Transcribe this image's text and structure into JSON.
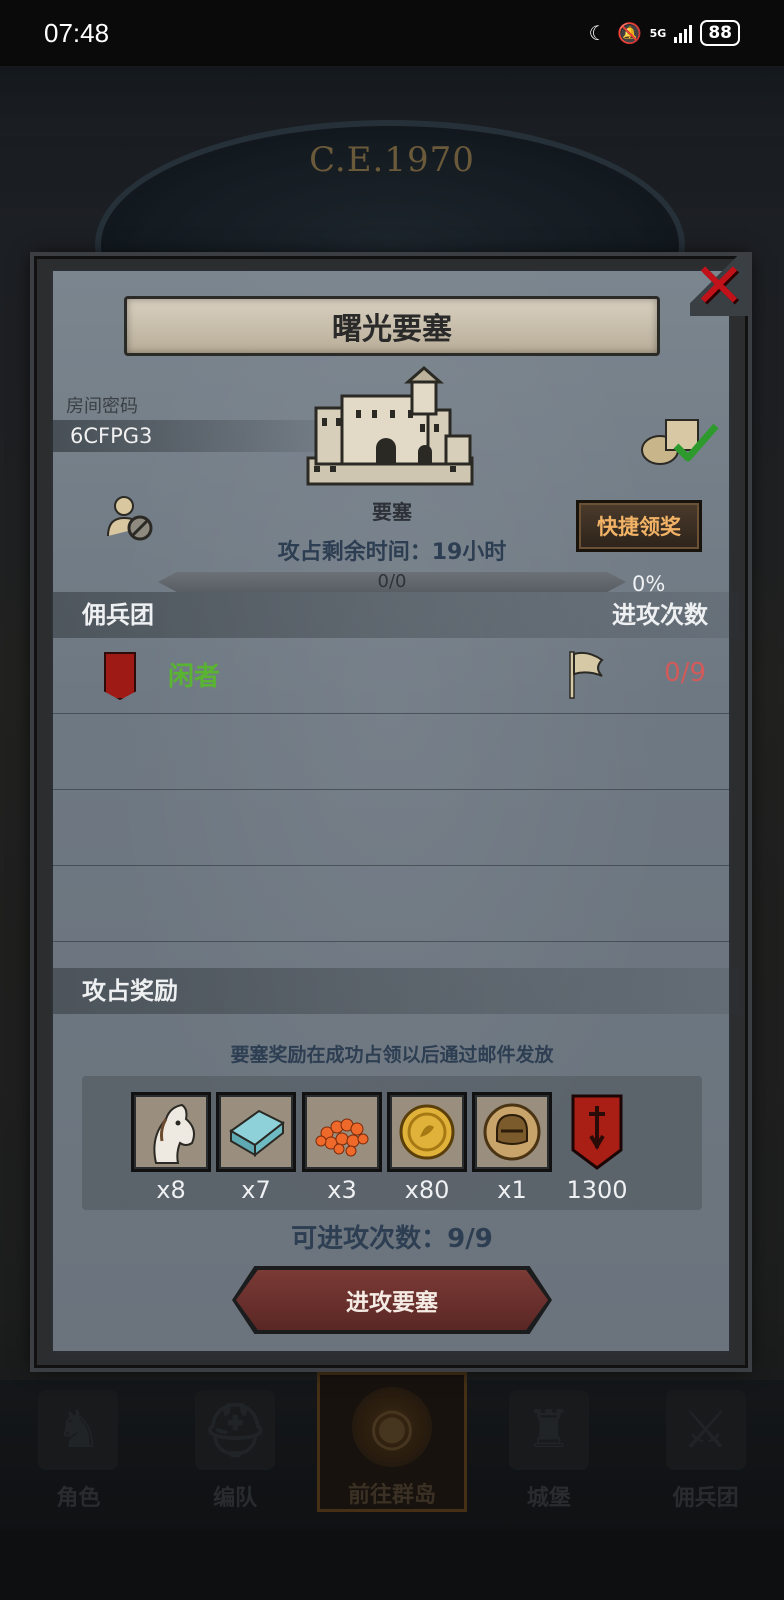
{
  "status_bar": {
    "time": "07:48",
    "network": "5G",
    "battery": "88"
  },
  "background": {
    "era": "C.E.1970"
  },
  "dialog": {
    "title": "曙光要塞",
    "room_label": "房间密码",
    "room_code": "6CFPG3",
    "castle_label": "要塞",
    "time_left": "攻占剩余时间：19小时",
    "quick_claim_label": "快捷领奖",
    "progress": {
      "text": "0/0",
      "percent_label": "0%",
      "fraction": 0
    },
    "mercenary": {
      "header_left": "佣兵团",
      "header_right": "进攻次数",
      "rows": [
        {
          "name": "闲者",
          "attacks": "0/9"
        }
      ]
    },
    "rewards": {
      "header": "攻占奖励",
      "note": "要塞奖励在成功占领以后通过邮件发放",
      "items": [
        {
          "icon": "horse-icon",
          "qty": "x8"
        },
        {
          "icon": "cloth-icon",
          "qty": "x7"
        },
        {
          "icon": "fish-roe-icon",
          "qty": "x3"
        },
        {
          "icon": "gold-coin-icon",
          "qty": "x80"
        },
        {
          "icon": "knight-helmet-icon",
          "qty": "x1"
        },
        {
          "icon": "guild-emblem-icon",
          "qty": "1300"
        }
      ]
    },
    "can_attack": "可进攻次数：9/9",
    "attack_button": "进攻要塞"
  },
  "bottom_nav": {
    "items": [
      {
        "label": "角色"
      },
      {
        "label": "编队"
      },
      {
        "label": "前往群岛"
      },
      {
        "label": "城堡"
      },
      {
        "label": "佣兵团"
      }
    ]
  },
  "colors": {
    "close": "#c1121a",
    "guild_name": "#59b431",
    "attack_count": "#d35a5a",
    "quick_claim_text": "#f2b366",
    "attack_button": "#7b3a36"
  }
}
